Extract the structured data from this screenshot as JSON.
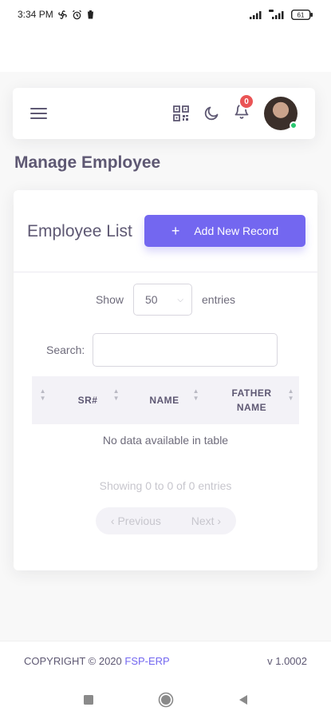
{
  "status_bar": {
    "time": "3:34 PM",
    "battery": "61"
  },
  "navbar": {
    "notification_count": "0"
  },
  "page": {
    "title": "Manage Employee"
  },
  "card": {
    "title": "Employee List",
    "add_button_label": "Add New Record",
    "show_label": "Show",
    "entries_value": "50",
    "entries_label": "entries",
    "search_label": "Search:",
    "search_value": "",
    "table": {
      "columns": [
        "",
        "SR#",
        "NAME",
        "FATHER NAME"
      ],
      "empty_message": "No data available in table"
    },
    "info_text": "Showing 0 to 0 of 0 entries",
    "pagination": {
      "previous": "‹ Previous",
      "next": "Next ›"
    }
  },
  "footer": {
    "copyright_prefix": "COPYRIGHT © 2020 ",
    "brand": "FSP-ERP",
    "version": "v 1.0002"
  },
  "colors": {
    "primary": "#7367f0",
    "danger": "#ea5455",
    "success": "#28c76f"
  }
}
